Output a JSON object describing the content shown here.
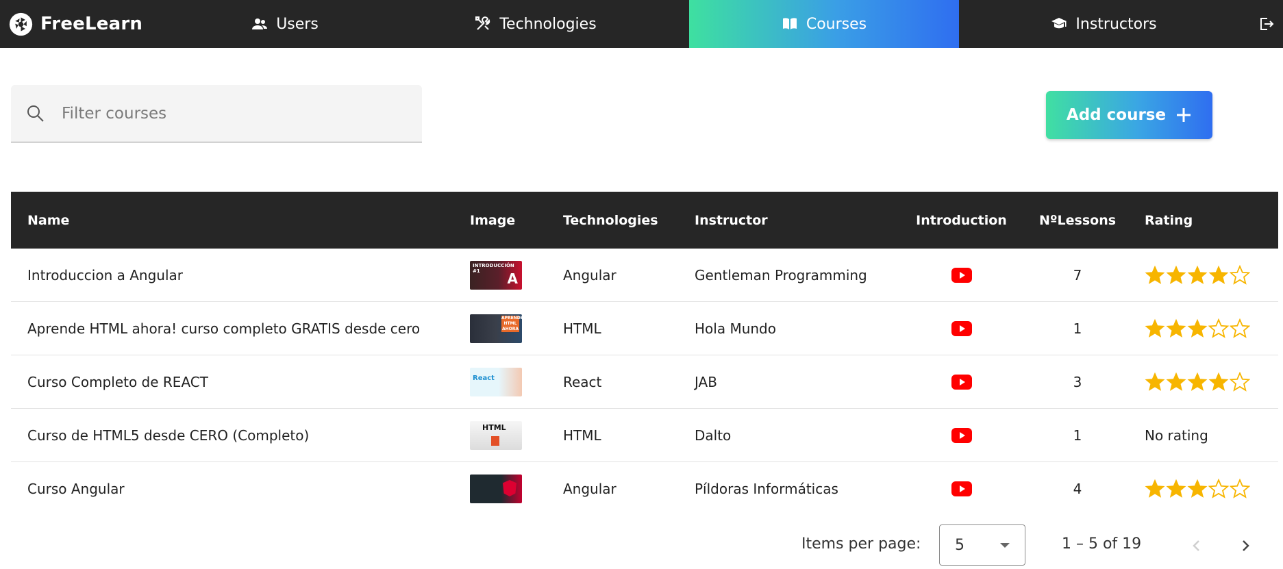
{
  "nav": {
    "brand": "FreeLearn",
    "items": [
      {
        "label": "Users",
        "icon": "users-icon"
      },
      {
        "label": "Technologies",
        "icon": "tools-icon"
      },
      {
        "label": "Courses",
        "icon": "book-icon",
        "active": true
      },
      {
        "label": "Instructors",
        "icon": "graduation-cap-icon"
      }
    ],
    "logout_icon": "logout-icon"
  },
  "filter": {
    "placeholder": "Filter courses"
  },
  "add_button": {
    "label": "Add course"
  },
  "table": {
    "columns": [
      "Name",
      "Image",
      "Technologies",
      "Instructor",
      "Introduction",
      "NºLessons",
      "Rating"
    ],
    "rows": [
      {
        "name": "Introduccion a Angular",
        "thumb_text": "INTRODUCCIÓN #1",
        "technology": "Angular",
        "instructor": "Gentleman Programming",
        "lessons": "7",
        "rating": 4,
        "rating_text": ""
      },
      {
        "name": "Aprende HTML ahora! curso completo GRATIS desde cero",
        "thumb_text": "APRENDE HTML AHORA",
        "technology": "HTML",
        "instructor": "Hola Mundo",
        "lessons": "1",
        "rating": 3,
        "rating_text": ""
      },
      {
        "name": "Curso Completo de REACT",
        "thumb_text": "React",
        "technology": "React",
        "instructor": "JAB",
        "lessons": "3",
        "rating": 4,
        "rating_text": ""
      },
      {
        "name": "Curso de HTML5 desde CERO (Completo)",
        "thumb_text": "HTML",
        "technology": "HTML",
        "instructor": "Dalto",
        "lessons": "1",
        "rating": null,
        "rating_text": "No rating"
      },
      {
        "name": "Curso Angular",
        "thumb_text": "",
        "technology": "Angular",
        "instructor": "Píldoras Informáticas",
        "lessons": "4",
        "rating": 3,
        "rating_text": ""
      }
    ]
  },
  "paginator": {
    "items_per_page_label": "Items per page:",
    "page_size": "5",
    "range_label": "1 – 5 of 19"
  },
  "colors": {
    "nav_bg": "#262626",
    "accent_start": "#3ee0a0",
    "accent_end": "#2f6ef0",
    "star": "#f7b500",
    "youtube": "#ff0000"
  }
}
